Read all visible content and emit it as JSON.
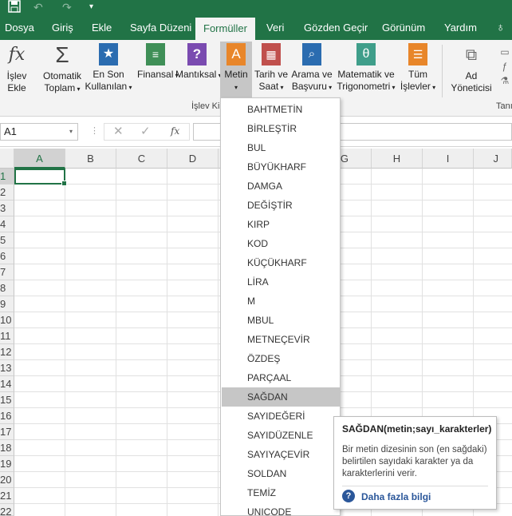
{
  "qat": {
    "save_icon": "save-icon",
    "undo_icon": "undo-icon",
    "redo_icon": "redo-icon",
    "customize_icon": "customize-icon"
  },
  "tabs": [
    "Dosya",
    "Giriş",
    "Ekle",
    "Sayfa Düzeni",
    "Formüller",
    "Veri",
    "Gözden Geçir",
    "Görünüm",
    "Yardım"
  ],
  "active_tab": "Formüller",
  "tell_me_icon": "lightbulb-icon",
  "ribbon": {
    "insert_function": [
      "İşlev",
      "Ekle"
    ],
    "autosum": [
      "Otomatik",
      "Toplam"
    ],
    "recent": [
      "En Son",
      "Kullanılan"
    ],
    "financial": "Finansal",
    "logical": "Mantıksal",
    "text": "Metin",
    "datetime": [
      "Tarih ve",
      "Saat"
    ],
    "lookup": [
      "Arama ve",
      "Başvuru"
    ],
    "math": [
      "Matematik ve",
      "Trigonometri"
    ],
    "more": [
      "Tüm",
      "İşlevler"
    ],
    "name_manager": [
      "Ad",
      "Yöneticisi"
    ],
    "group_library": "İşlev Ki",
    "group_defined": "Tanı"
  },
  "formula_bar": {
    "name_box": "A1",
    "fx": "fx"
  },
  "columns": [
    "A",
    "B",
    "C",
    "D",
    "G",
    "H",
    "I",
    "J"
  ],
  "rows": [
    "1",
    "2",
    "3",
    "4",
    "5",
    "6",
    "7",
    "8",
    "9",
    "10",
    "11",
    "12",
    "13",
    "14",
    "15",
    "16",
    "17",
    "18",
    "19",
    "20",
    "21",
    "22"
  ],
  "text_functions": [
    "BAHTMETİN",
    "BİRLEŞTİR",
    "BUL",
    "BÜYÜKHARF",
    "DAMGA",
    "DEĞİŞTİR",
    "KIRP",
    "KOD",
    "KÜÇÜKHARF",
    "LİRA",
    "M",
    "MBUL",
    "METNEÇEVİR",
    "ÖZDEŞ",
    "PARÇAAL",
    "SAĞDAN",
    "SAYIDEĞERİ",
    "SAYIDÜZENLE",
    "SAYIYAÇEVİR",
    "SOLDAN",
    "TEMİZ",
    "UNICODE"
  ],
  "highlighted_function": "SAĞDAN",
  "tooltip": {
    "title": "SAĞDAN(metin;sayı_karakterler)",
    "body": "Bir metin dizesinin son (en sağdaki) belirtilen sayıdaki karakter ya da karakterlerini verir.",
    "link": "Daha fazla bilgi"
  },
  "colors": {
    "accent": "#217346",
    "highlight": "#c6c6c6",
    "link": "#2b579a"
  }
}
